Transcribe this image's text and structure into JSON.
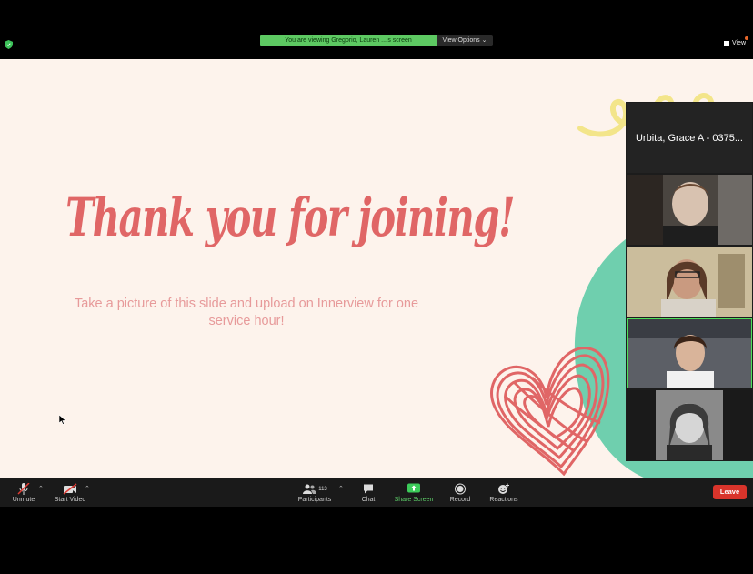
{
  "top_bar": {
    "viewing_text": "You are viewing Gregorio, Lauren ...'s screen",
    "view_options_label": "View Options ⌄",
    "view_label": "View"
  },
  "slide": {
    "title": "Thank you for joining!",
    "subtitle": "Take a picture of this slide and upload on Innerview for one service hour!"
  },
  "participants_panel": {
    "tiles": [
      {
        "name": "Urbita, Grace A - 0375..."
      }
    ]
  },
  "toolbar": {
    "unmute_label": "Unmute",
    "start_video_label": "Start Video",
    "participants_label": "Participants",
    "participants_count": "113",
    "chat_label": "Chat",
    "share_screen_label": "Share Screen",
    "record_label": "Record",
    "reactions_label": "Reactions",
    "leave_label": "Leave"
  },
  "colors": {
    "accent_green": "#5dc962",
    "leave_red": "#d9342b",
    "slide_bg": "#fdf3ec",
    "title_coral": "#e06666",
    "teal_shape": "#6fcfae",
    "yellow_squiggle": "#f3e58a"
  }
}
